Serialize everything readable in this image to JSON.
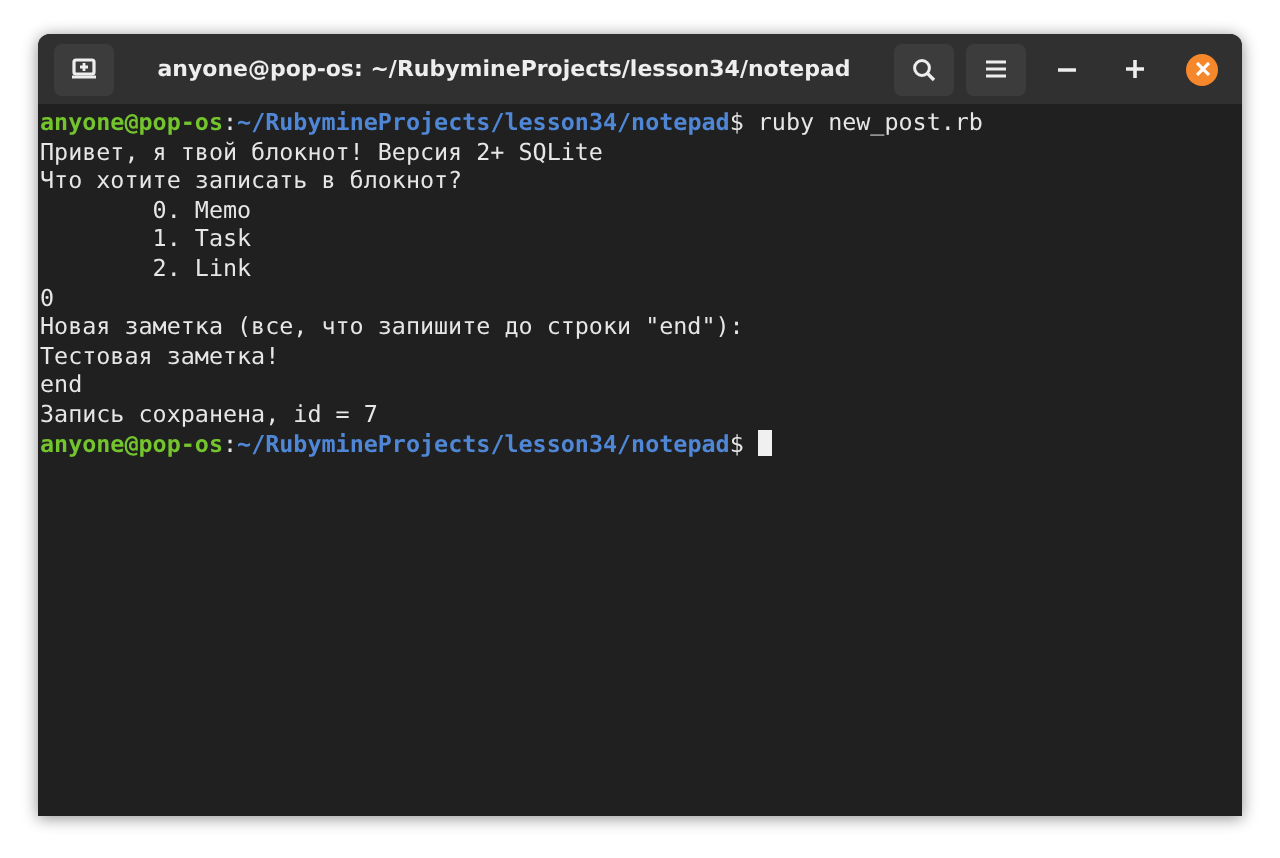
{
  "window": {
    "title": "anyone@pop-os: ~/RubymineProjects/lesson34/notepad"
  },
  "terminal": {
    "lines": [
      {
        "cursor": false,
        "segments": [
          {
            "kind": "user",
            "text": "anyone@pop-os"
          },
          {
            "kind": "plain",
            "text": ":"
          },
          {
            "kind": "path",
            "text": "~/RubymineProjects/lesson34/notepad"
          },
          {
            "kind": "plain",
            "text": "$ ruby new_post.rb"
          }
        ]
      },
      {
        "cursor": false,
        "segments": [
          {
            "kind": "plain",
            "text": "Привет, я твой блокнот! Версия 2+ SQLite"
          }
        ]
      },
      {
        "cursor": false,
        "segments": [
          {
            "kind": "plain",
            "text": "Что хотите записать в блокнот?"
          }
        ]
      },
      {
        "cursor": false,
        "segments": [
          {
            "kind": "plain",
            "text": "\t0. Memo"
          }
        ]
      },
      {
        "cursor": false,
        "segments": [
          {
            "kind": "plain",
            "text": "\t1. Task"
          }
        ]
      },
      {
        "cursor": false,
        "segments": [
          {
            "kind": "plain",
            "text": "\t2. Link"
          }
        ]
      },
      {
        "cursor": false,
        "segments": [
          {
            "kind": "plain",
            "text": "0"
          }
        ]
      },
      {
        "cursor": false,
        "segments": [
          {
            "kind": "plain",
            "text": "Новая заметка (все, что запишите до строки \"end\"):"
          }
        ]
      },
      {
        "cursor": false,
        "segments": [
          {
            "kind": "plain",
            "text": "Тестовая заметка!"
          }
        ]
      },
      {
        "cursor": false,
        "segments": [
          {
            "kind": "plain",
            "text": "end"
          }
        ]
      },
      {
        "cursor": false,
        "segments": [
          {
            "kind": "plain",
            "text": "Запись сохранена, id = 7"
          }
        ]
      },
      {
        "cursor": true,
        "segments": [
          {
            "kind": "user",
            "text": "anyone@pop-os"
          },
          {
            "kind": "plain",
            "text": ":"
          },
          {
            "kind": "path",
            "text": "~/RubymineProjects/lesson34/notepad"
          },
          {
            "kind": "plain",
            "text": "$ "
          }
        ]
      }
    ]
  }
}
